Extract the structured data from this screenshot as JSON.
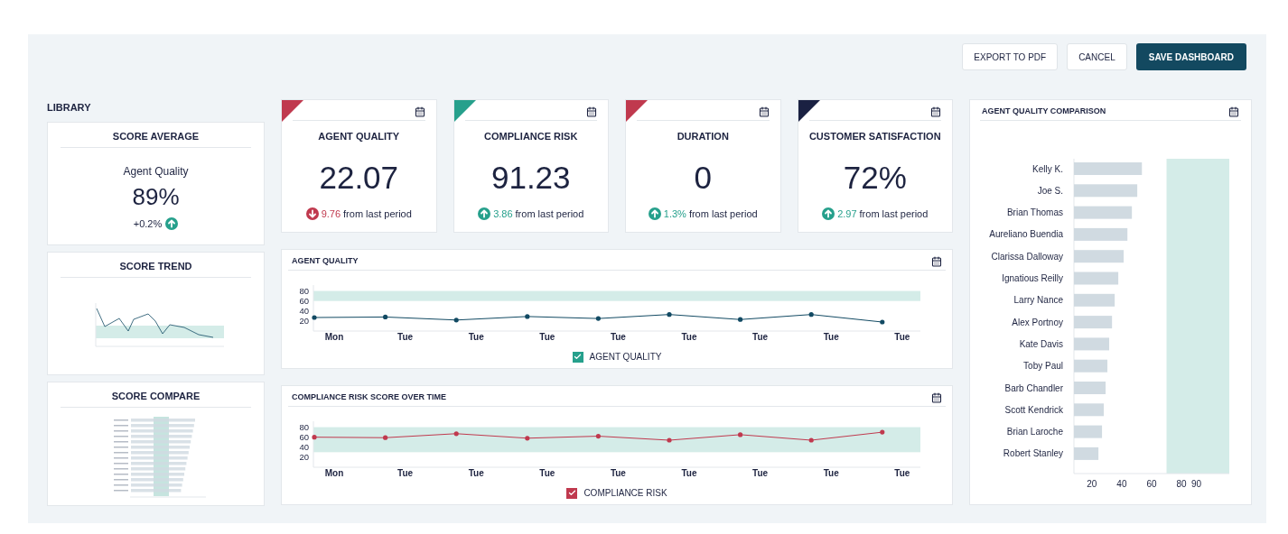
{
  "toolbar": {
    "buttons": [
      {
        "label": "EXPORT TO PDF",
        "kind": "outline"
      },
      {
        "label": "CANCEL",
        "kind": "outline"
      },
      {
        "label": "SAVE DASHBOARD",
        "kind": "primary"
      }
    ]
  },
  "library": {
    "title": "LIBRARY",
    "score_average": {
      "title": "SCORE AVERAGE",
      "metric": "Agent Quality",
      "value": "89%",
      "delta": "+0.2%",
      "kind": "up"
    },
    "score_trend": {
      "title": "SCORE TREND"
    },
    "score_compare": {
      "title": "SCORE COMPARE"
    }
  },
  "kpis": [
    {
      "title": "AGENT QUALITY",
      "value": "22.07",
      "delta": "9.76",
      "suffix": "from last period",
      "kind": "down",
      "color": "#c0394e"
    },
    {
      "title": "COMPLIANCE RISK",
      "value": "91.23",
      "delta": "3.86",
      "suffix": "from last period",
      "kind": "up",
      "color": "#26a08c"
    },
    {
      "title": "DURATION",
      "value": "0",
      "delta": "1.3%",
      "suffix": "from last period",
      "kind": "up",
      "color": "#c0394e"
    },
    {
      "title": "CUSTOMER SATISFACTION",
      "value": "72%",
      "delta": "2.97",
      "suffix": "from last period",
      "kind": "up",
      "color": "#1a2142"
    }
  ],
  "line_charts": [
    {
      "title": "AGENT QUALITY",
      "legend": {
        "checked": true,
        "color": "#26a08c"
      },
      "chart_data": {
        "type": "line",
        "categories": [
          "Mon",
          "Tue",
          "Tue",
          "Tue",
          "Tue",
          "Tue",
          "Tue",
          "Tue",
          "Tue"
        ],
        "ylim": [
          0,
          90
        ],
        "yticks": [
          20,
          40,
          60,
          80
        ],
        "series": [
          {
            "name": "AGENT QUALITY",
            "color": "#124a63",
            "values": [
              27,
              28,
              22,
              29,
              25,
              33,
              23,
              33,
              18
            ]
          }
        ],
        "bands": [
          {
            "axis": "y",
            "from": 60,
            "to": 80,
            "color": "#d4ece8"
          }
        ]
      }
    },
    {
      "title": "COMPLIANCE RISK SCORE OVER TIME",
      "legend": {
        "checked": true,
        "color": "#c0394e"
      },
      "chart_data": {
        "type": "line",
        "categories": [
          "Mon",
          "Tue",
          "Tue",
          "Tue",
          "Tue",
          "Tue",
          "Tue",
          "Tue",
          "Tue"
        ],
        "ylim": [
          0,
          90
        ],
        "yticks": [
          20,
          40,
          60,
          80
        ],
        "series": [
          {
            "name": "COMPLIANCE RISK",
            "color": "#c0394e",
            "values": [
              60,
              59,
              67,
              58,
              62,
              54,
              65,
              54,
              70
            ]
          }
        ],
        "bands": [
          {
            "axis": "y",
            "from": 30,
            "to": 80,
            "color": "#d4ece8"
          }
        ]
      }
    }
  ],
  "comparison": {
    "title": "AGENT QUALITY COMPARISON",
    "chart_data": {
      "type": "bar",
      "orientation": "horizontal",
      "categories": [
        "Kelly K.",
        "Joe S.",
        "Brian Thomas",
        "Aureliano Buendia",
        "Clarissa Dalloway",
        "Ignatious Reilly",
        "Larry Nance",
        "Alex Portnoy",
        "Kate Davis",
        "Toby Paul",
        "Barb Chandler",
        "Scott Kendrick",
        "Brian Laroche",
        "Robert Stanley"
      ],
      "values": [
        53.5,
        50.4,
        46.8,
        43.8,
        41.3,
        37.7,
        35.3,
        33.5,
        31.6,
        30.4,
        29.2,
        28,
        26.8,
        24.4
      ],
      "xlim": [
        8,
        112
      ],
      "xticks": [
        20,
        40,
        60,
        80,
        90
      ],
      "bands": [
        {
          "axis": "x",
          "from": 70,
          "to": 112,
          "color": "#d4ece8"
        }
      ]
    }
  }
}
